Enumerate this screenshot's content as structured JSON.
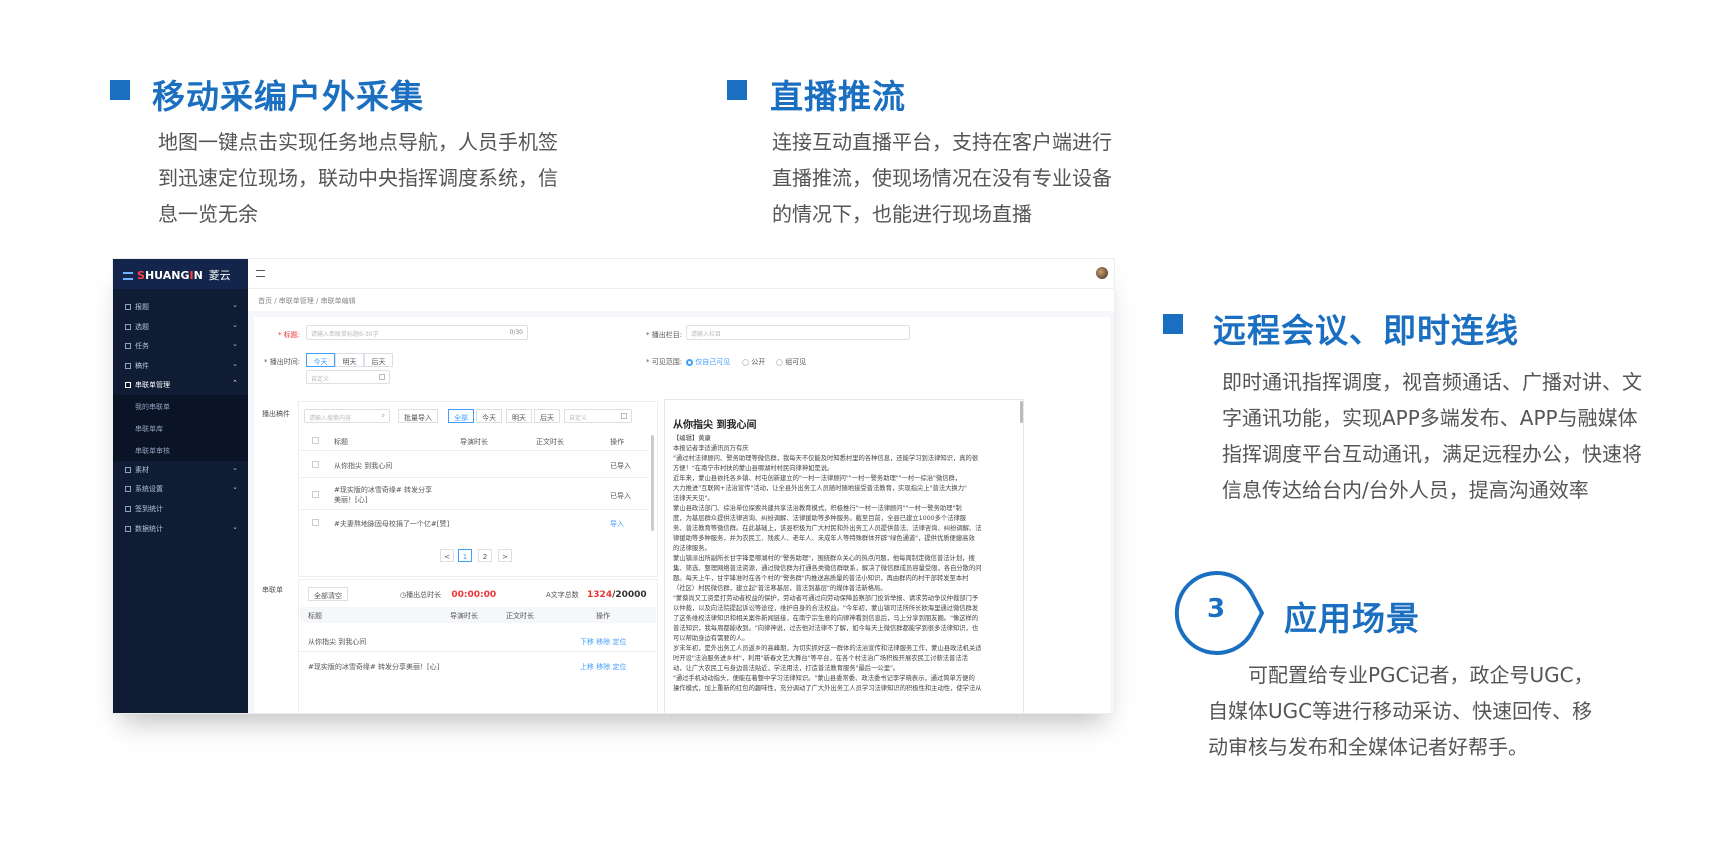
{
  "sections": {
    "mobile": {
      "title": "移动采编户外采集",
      "lines": [
        "地图一键点击实现任务地点导航，人员手机签",
        "到迅速定位现场，联动中央指挥调度系统，信",
        "息一览无余"
      ]
    },
    "live": {
      "title": "直播推流",
      "lines": [
        "连接互动直播平台，支持在客户端进行",
        "直播推流，使现场情况在没有专业设备",
        "的情况下，也能进行现场直播"
      ]
    },
    "remote": {
      "title": "远程会议、即时连线",
      "lines": [
        "即时通讯指挥调度，视音频通话、广播对讲、文",
        "字通讯功能，实现APP多端发布、APP与融媒体",
        "指挥调度平台互动通讯，满足远程办公，快速将",
        "信息传达给台内/台外人员，提高沟通效率"
      ]
    },
    "scene": {
      "number": "3",
      "title": "应用场景",
      "lines": [
        "可配置给专业PGC记者，政企号UGC，",
        "自媒体UGC等进行移动采访、快速回传、移",
        "动审核与发布和全媒体记者好帮手。"
      ]
    }
  },
  "app": {
    "logo": {
      "brand_a": "S",
      "brand_b": "HUANG",
      "brand_c": "I",
      "brand_d": "N",
      "brand_cn": "菱云"
    },
    "nav": [
      {
        "label": "报题",
        "icon": "report-icon"
      },
      {
        "label": "选题",
        "icon": "topic-icon"
      },
      {
        "label": "任务",
        "icon": "task-icon"
      },
      {
        "label": "稿件",
        "icon": "manuscript-icon"
      },
      {
        "label": "串联单管理",
        "icon": "rundown-icon"
      },
      {
        "label": "素材",
        "icon": "material-icon"
      },
      {
        "label": "系统设置",
        "icon": "settings-icon"
      },
      {
        "label": "签到统计",
        "icon": "checkin-icon"
      },
      {
        "label": "数据统计",
        "icon": "stats-icon"
      }
    ],
    "subnav": [
      "我的串联单",
      "串联单库",
      "串联单审核"
    ],
    "breadcrumb": "首页  /  串联单管理  /  串联单编辑",
    "form": {
      "title_label": "* 标题:",
      "title_placeholder": "请输入串联单标题6-30字",
      "title_count": "0/30",
      "column_label": "* 播出栏目:",
      "column_placeholder": "请输入栏目",
      "time_label": "* 播出时间:",
      "time_options": [
        "今天",
        "明天",
        "后天"
      ],
      "custom_placeholder": "自定义",
      "visibility_label": "* 可见范围:",
      "visibility_options": [
        "仅自己可见",
        "公开",
        "组可见"
      ],
      "manuscript_label": "播出稿件",
      "rundown_label": "串联单"
    },
    "search": {
      "placeholder": "请输入搜索内容",
      "import_button": "批量导入",
      "filters": [
        "全部",
        "今天",
        "明天",
        "后天"
      ],
      "custom": "自定义"
    },
    "table": {
      "headers": [
        "标题",
        "导演时长",
        "正文时长",
        "操作"
      ],
      "rows": [
        {
          "title": "从你指尖 到我心间",
          "action": "已导入"
        },
        {
          "title": "#现实版的冰雪奇缘# 转发分享美丽！[心]",
          "action": "已导入"
        },
        {
          "title": "#夫妻熬地脉固母校捐了一个亿#[赞]",
          "action": "导入"
        }
      ],
      "pages": [
        "<",
        "1",
        "2",
        ">"
      ]
    },
    "rundown": {
      "clear_button": "全部清空",
      "duration_label": "播出总时长",
      "duration_value": "00:00:00",
      "words_label": "文字总数",
      "words_value": "1324",
      "words_max": "/20000",
      "headers": [
        "标题",
        "导演时长",
        "正文时长",
        "操作"
      ],
      "rows": [
        {
          "title": "从你指尖 到我心间",
          "actions": "下移  移除  定位"
        },
        {
          "title": "#现实版的冰雪奇缘# 转发分享美丽！[心]",
          "actions": "上移  移除  定位"
        }
      ]
    },
    "article": {
      "title": "从你指尖 到我心间",
      "lines": [
        "【编辑】黄康",
        "本报记者李适通讯员万有庆",
        "\"通过村法律顾问、警务助理等微信群，我每天不仅能及时知悉村里的各种信息，还能学习到法律知识，真的很",
        "方便！\"在南宁市村扶的蒙山县哪湖村村民向律神如是说。",
        "近年来，蒙山县依托各乡镇、村屯创新建立的\"一村一法律顾问\"\"一村一警务助理\"\"一村一综治\"微信群，",
        "大力推进\"互联网+法治宣传\"活动，让全县外出务工人员随时随地接受普法教育，实现指尖上\"普法大换力\"",
        "法律天天见\"。",
        "蒙山县政法部门、综治单位探索共建共享法治教育模式，积极推行\"一村一法律顾问\"\"一村一警务助理\"制",
        "度，为基层群众提供法律咨询、纠纷调解、法律援助等多种服务。截至目前，全县已建立1000多个法律服",
        "务、普法教育等微信群。在此基础上，该县积极为广大村民和外出务工人员提供普法、法律咨询、纠纷调解、法",
        "律援助等多种服务，并为农民工、残疾人、老年人、未成年人等特殊群体开辟\"绿色通道\"，提供优质便捷高效",
        "的法律服务。",
        "蒙山镇派出所副所长甘宇锋是哪湖村的\"警务助理\"，围绕群众关心的热点问题，他每周制定微信普法计划，搜",
        "集、筛选、整理网络普法资源，通过微信群为打通各类微信群联系，解决了微信群成员容量受限，各自分散的问",
        "题。每天上午，甘宇锋准时在各个村的\"警务群\"内推送高质量的普法小知识，再由群内的村干部转发至本村",
        "（社区）村民微信群，建立起\"普法寒基层，普法到基层\"的媒体普法新格局。",
        "\"蒙蔡尚又工资是打劳动者权益的保护，劳动者可通过向劳动保障监察部门投诉举报、请求劳动争议仲裁部门予",
        "以仲裁，以及向法院提起诉讼等途径，维护自身的合法权益。\"今年初，蒙山镇司法所所长欧海里通过微信群发",
        "了这条维权法律知识和相关案件新闻链接，在南宁宗生意的向律神看到信息后，马上分享到朋友圈。\"像这样的",
        "普法知识，我每周都能收到。\"向律神说，过去他对法律不了解，如今每天上微信群都能学到很多法律知识，也",
        "可以帮助身边有需要的人。",
        "岁末年初，是外出务工人员返乡的高峰期，为切实抓好这一群体的法治宣传和法律服务工作，蒙山县政法机关适",
        "时开设\"法治服务进乡村\"，利用\"新春文艺大舞台\"等平台，在各个村法治广场积极开展农民工讨薪法普法活",
        "动，让广大农民工与身边普法贴近，学法用法，打造普法教育服务\"最后一公里\"。",
        "\"通过手机动动指头，便能在着整中学习法律知识。\"蒙山县委常委、政法委书记李学晓表示，通过简单方便的",
        "操作模式，加上重新的红包的趣味性，充分调动了广大外出务工人员学习法律知识的积极性和主动性，使学法从"
      ]
    }
  }
}
